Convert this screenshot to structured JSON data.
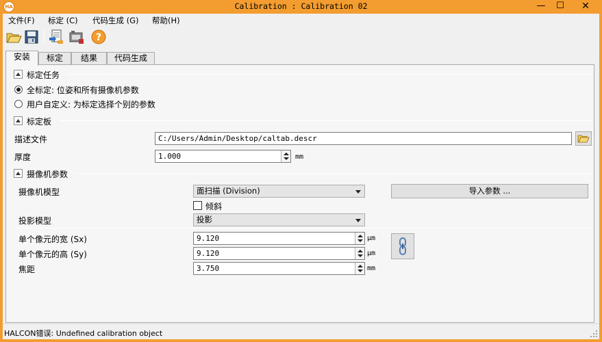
{
  "window": {
    "title": "Calibration : Calibration 02",
    "logo_text": "HA",
    "minimize": "—",
    "maximize": "☐",
    "close": "✕"
  },
  "menu": [
    "文件(F)",
    "标定 (C)",
    "代码生成 (G)",
    "帮助(H)"
  ],
  "toolbar": {
    "icons": [
      "open-folder-icon",
      "save-icon",
      "load-calibration-icon",
      "camera-icon",
      "help-icon"
    ],
    "help_glyph": "?"
  },
  "tabs": [
    "安装",
    "标定",
    "结果",
    "代码生成"
  ],
  "active_tab": "安装",
  "task": {
    "header": "标定任务",
    "options": [
      {
        "label": "全标定: 位姿和所有摄像机参数",
        "checked": true
      },
      {
        "label": "用户自定义: 为标定选择个别的参数",
        "checked": false
      }
    ]
  },
  "plate": {
    "header": "标定板",
    "desc_label": "描述文件",
    "desc_value": "C:/Users/Admin/Desktop/caltab.descr",
    "thickness_label": "厚度",
    "thickness_value": "1.000",
    "thickness_unit": "mm"
  },
  "camera": {
    "header": "摄像机参数",
    "model_label": "摄像机模型",
    "model_value": "面扫描 (Division)",
    "import_button": "导入参数 ...",
    "tilt_label": "倾斜",
    "tilt_checked": false,
    "projection_label": "投影模型",
    "projection_value": "投影",
    "sx_label": "单个像元的宽 (Sx)",
    "sx_value": "9.120",
    "sx_unit": "μm",
    "sy_label": "单个像元的高 (Sy)",
    "sy_value": "9.120",
    "sy_unit": "μm",
    "focal_label": "焦距",
    "focal_value": "3.750",
    "focal_unit": "mm"
  },
  "status": {
    "text": "HALCON错误: Undefined calibration object"
  },
  "colors": {
    "frame": "#f39c2f",
    "background": "#f0f0f0",
    "panel": "#f6f6f6"
  }
}
